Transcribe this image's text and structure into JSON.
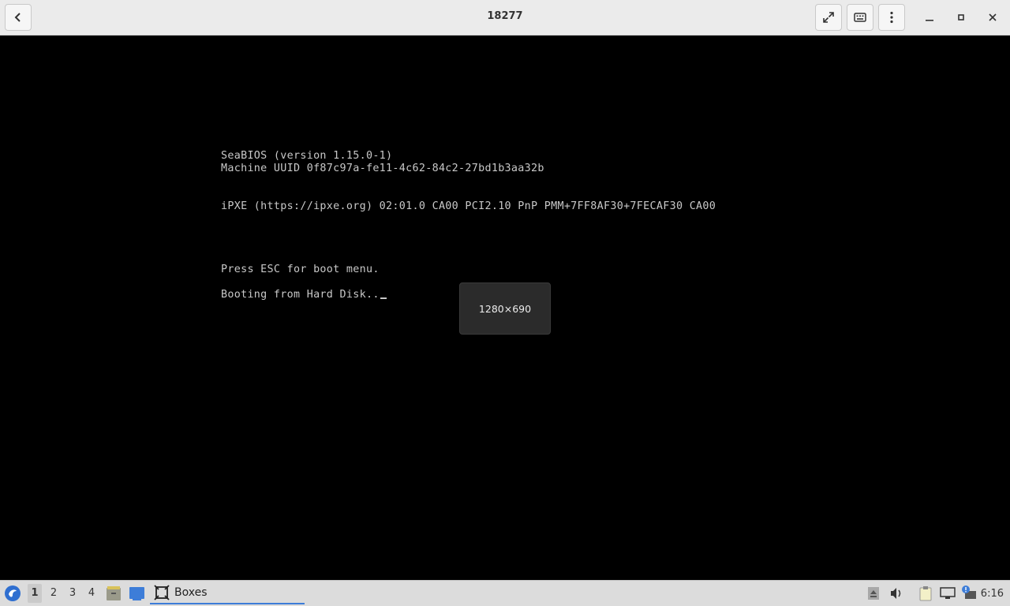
{
  "window": {
    "title": "18277",
    "back_icon": "back-arrow-icon",
    "fullscreen_icon": "fullscreen-icon",
    "keyboard_icon": "keyboard-icon",
    "menu_icon": "kebab-menu-icon",
    "minimize_icon": "minimize-icon",
    "maximize_icon": "maximize-icon",
    "close_icon": "close-icon"
  },
  "console": {
    "lines": [
      "SeaBIOS (version 1.15.0-1)",
      "Machine UUID 0f87c97a-fe11-4c62-84c2-27bd1b3aa32b",
      "iPXE (https://ipxe.org) 02:01.0 CA00 PCI2.10 PnP PMM+7FF8AF30+7FECAF30 CA00",
      "Press ESC for boot menu.",
      "Booting from Hard Disk.."
    ]
  },
  "overlay": {
    "resolution": "1280×690"
  },
  "taskbar": {
    "workspaces": [
      "1",
      "2",
      "3",
      "4"
    ],
    "active_workspace": "1",
    "task_label": "Boxes",
    "clock": "6:16"
  }
}
